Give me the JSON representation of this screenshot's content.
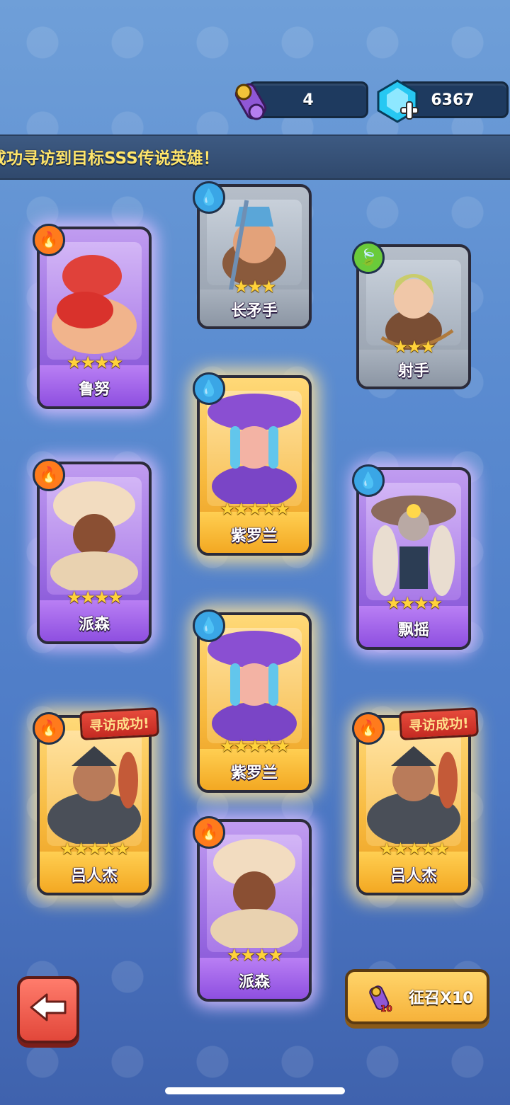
{
  "currency": {
    "scrolls": "4",
    "gems": "6367"
  },
  "banner": {
    "text": "成功寻访到目标SSS传说英雄！"
  },
  "cards": [
    {
      "name": "鲁努",
      "stars": "★★★★",
      "element": "fire"
    },
    {
      "name": "长矛手",
      "stars": "★★★",
      "element": "water"
    },
    {
      "name": "射手",
      "stars": "★★★",
      "element": "leaf"
    },
    {
      "name": "紫罗兰",
      "stars": "★★★★★",
      "element": "water"
    },
    {
      "name": "派森",
      "stars": "★★★★",
      "element": "fire"
    },
    {
      "name": "飘摇",
      "stars": "★★★★",
      "element": "water"
    },
    {
      "name": "紫罗兰",
      "stars": "★★★★★",
      "element": "water"
    },
    {
      "name": "吕人杰",
      "stars": "★★★★★",
      "element": "fire",
      "ribbon": "寻访成功!"
    },
    {
      "name": "吕人杰",
      "stars": "★★★★★",
      "element": "fire",
      "ribbon": "寻访成功!"
    },
    {
      "name": "派森",
      "stars": "★★★★",
      "element": "fire"
    }
  ],
  "buttons": {
    "summon": "征召X10",
    "summon_badge": "10"
  },
  "icons": {
    "fire": "🔥",
    "water": "💧",
    "leaf": "🍃"
  }
}
